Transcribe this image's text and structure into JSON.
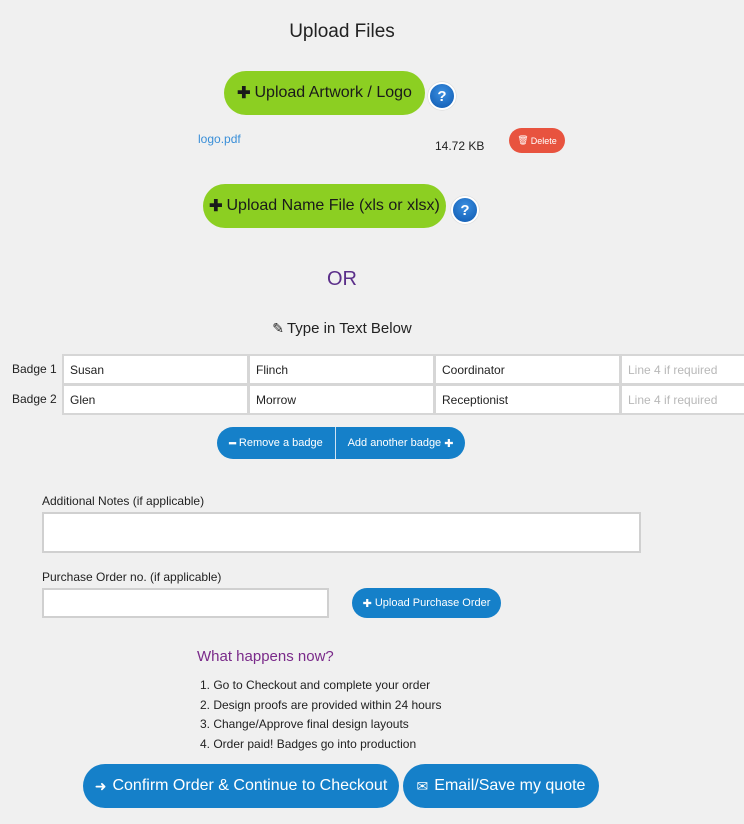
{
  "page": {
    "title": "Upload Files"
  },
  "uploads": {
    "artwork_button": "Upload Artwork / Logo",
    "name_file_button": "Upload Name File (xls or xlsx)",
    "help_glyph": "?",
    "plus_glyph": "✚",
    "files": [
      {
        "name": "logo.pdf",
        "size": "14.72 KB",
        "delete_label": "Delete"
      }
    ]
  },
  "divider": {
    "or_text": "OR",
    "type_below": "Type in Text Below",
    "icon": "edit-icon"
  },
  "badges": {
    "rows": [
      {
        "label": "Badge 1",
        "lines": [
          "Susan",
          "Flinch",
          "Coordinator",
          ""
        ]
      },
      {
        "label": "Badge 2",
        "lines": [
          "Glen",
          "Morrow",
          "Receptionist",
          ""
        ]
      }
    ],
    "line4_placeholder": "Line 4 if required",
    "remove_label": "Remove a badge",
    "add_label": "Add another badge"
  },
  "notes": {
    "label": "Additional Notes (if applicable)",
    "value": ""
  },
  "purchase_order": {
    "label": "Purchase Order no. (if applicable)",
    "value": "",
    "upload_label": "Upload Purchase Order"
  },
  "what_happens": {
    "title": "What happens now?",
    "steps": [
      "1. Go to Checkout and complete your order",
      "2. Design proofs are provided within 24 hours",
      "3. Change/Approve final design layouts",
      "4. Order paid! Badges go into production"
    ]
  },
  "actions": {
    "confirm_label": "Confirm Order & Continue to Checkout",
    "email_label": "Email/Save my quote"
  },
  "colors": {
    "green": "#8ccf22",
    "blue": "#1580c9",
    "delete": "#e8533f",
    "or_purple": "#5b2f8a",
    "heading_purple": "#7a2a8a",
    "link": "#3a8fd8"
  }
}
